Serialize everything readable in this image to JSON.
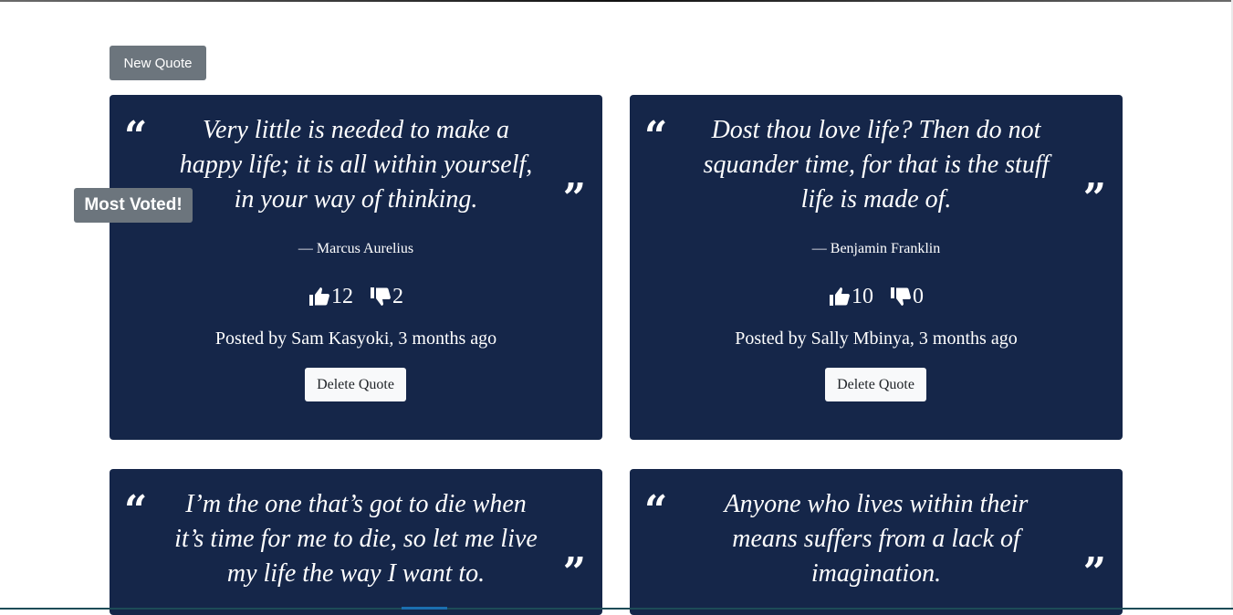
{
  "toolbar": {
    "new_quote_label": "New Quote"
  },
  "badge": {
    "most_voted_label": "Most Voted!"
  },
  "icons": {
    "open_quote": "“",
    "close_quote": "”",
    "upvote": "thumbs-up-icon",
    "downvote": "thumbs-down-icon"
  },
  "colors": {
    "card_bg": "#152649",
    "button_secondary": "#6c757d",
    "button_light": "#f8f9fa"
  },
  "quotes": [
    {
      "text": "Very little is needed to make a happy life; it is all within yourself, in your way of thinking.",
      "author": "— Marcus Aurelius",
      "upvotes": "12",
      "downvotes": "2",
      "posted": "Posted by Sam Kasyoki, 3 months ago",
      "delete_label": "Delete Quote"
    },
    {
      "text": "Dost thou love life? Then do not squander time, for that is the stuff life is made of.",
      "author": "— Benjamin Franklin",
      "upvotes": "10",
      "downvotes": "0",
      "posted": "Posted by Sally Mbinya, 3 months ago",
      "delete_label": "Delete Quote"
    },
    {
      "text": "I’m the one that’s got to die when it’s time for me to die, so let me live my life the way I want to."
    },
    {
      "text": "Anyone who lives within their means suffers from a lack of imagination."
    }
  ]
}
